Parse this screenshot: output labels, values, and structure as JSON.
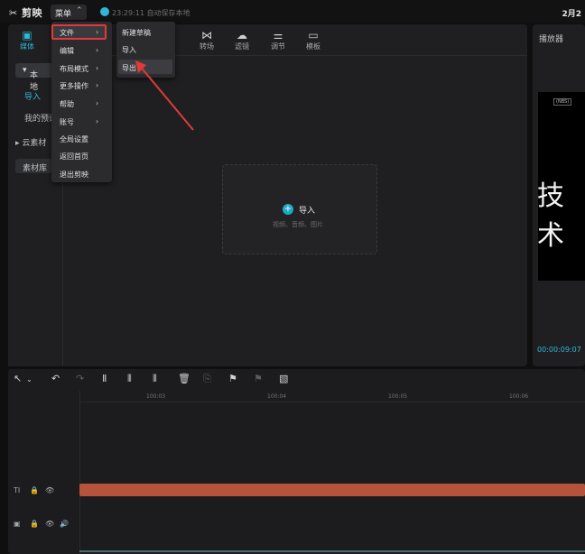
{
  "topbar": {
    "logo": "剪映",
    "menu_label": "菜单",
    "autosave": "23:29:11 自动保存本地",
    "date": "2月2"
  },
  "tabs": [
    {
      "label": "媒体",
      "icon": "media-icon"
    },
    {
      "label": "转场",
      "icon": "transition-icon"
    },
    {
      "label": "滤镜",
      "icon": "filter-icon"
    },
    {
      "label": "调节",
      "icon": "adjust-icon"
    },
    {
      "label": "模板",
      "icon": "template-icon"
    }
  ],
  "left_nav": {
    "local": "本地",
    "import": "导入",
    "mine": "我的预设",
    "cloud": "云素材",
    "library": "素材库"
  },
  "import_area": {
    "label": "导入",
    "hint": "视频、音频、图片"
  },
  "player": {
    "title": "播放器",
    "small_label": "(NBS)",
    "text": "技术",
    "time": "00:00:09:07"
  },
  "timeline": {
    "ticks": [
      "100:03",
      "100:04",
      "100:05",
      "100:06"
    ]
  },
  "menu": {
    "items": [
      {
        "label": "文件",
        "has_sub": true
      },
      {
        "label": "编辑",
        "has_sub": true
      },
      {
        "label": "布局模式",
        "has_sub": true
      },
      {
        "label": "更多操作",
        "has_sub": true
      },
      {
        "label": "帮助",
        "has_sub": true
      },
      {
        "label": "账号",
        "has_sub": true
      },
      {
        "label": "全局设置",
        "has_sub": false
      },
      {
        "label": "返回首页",
        "has_sub": false
      },
      {
        "label": "退出剪映",
        "has_sub": false
      }
    ],
    "file_submenu": [
      "新建草稿",
      "导入",
      "导出"
    ]
  },
  "colors": {
    "accent": "#2fb6d6",
    "highlight": "#e03a3a",
    "track": "#b5543b"
  }
}
